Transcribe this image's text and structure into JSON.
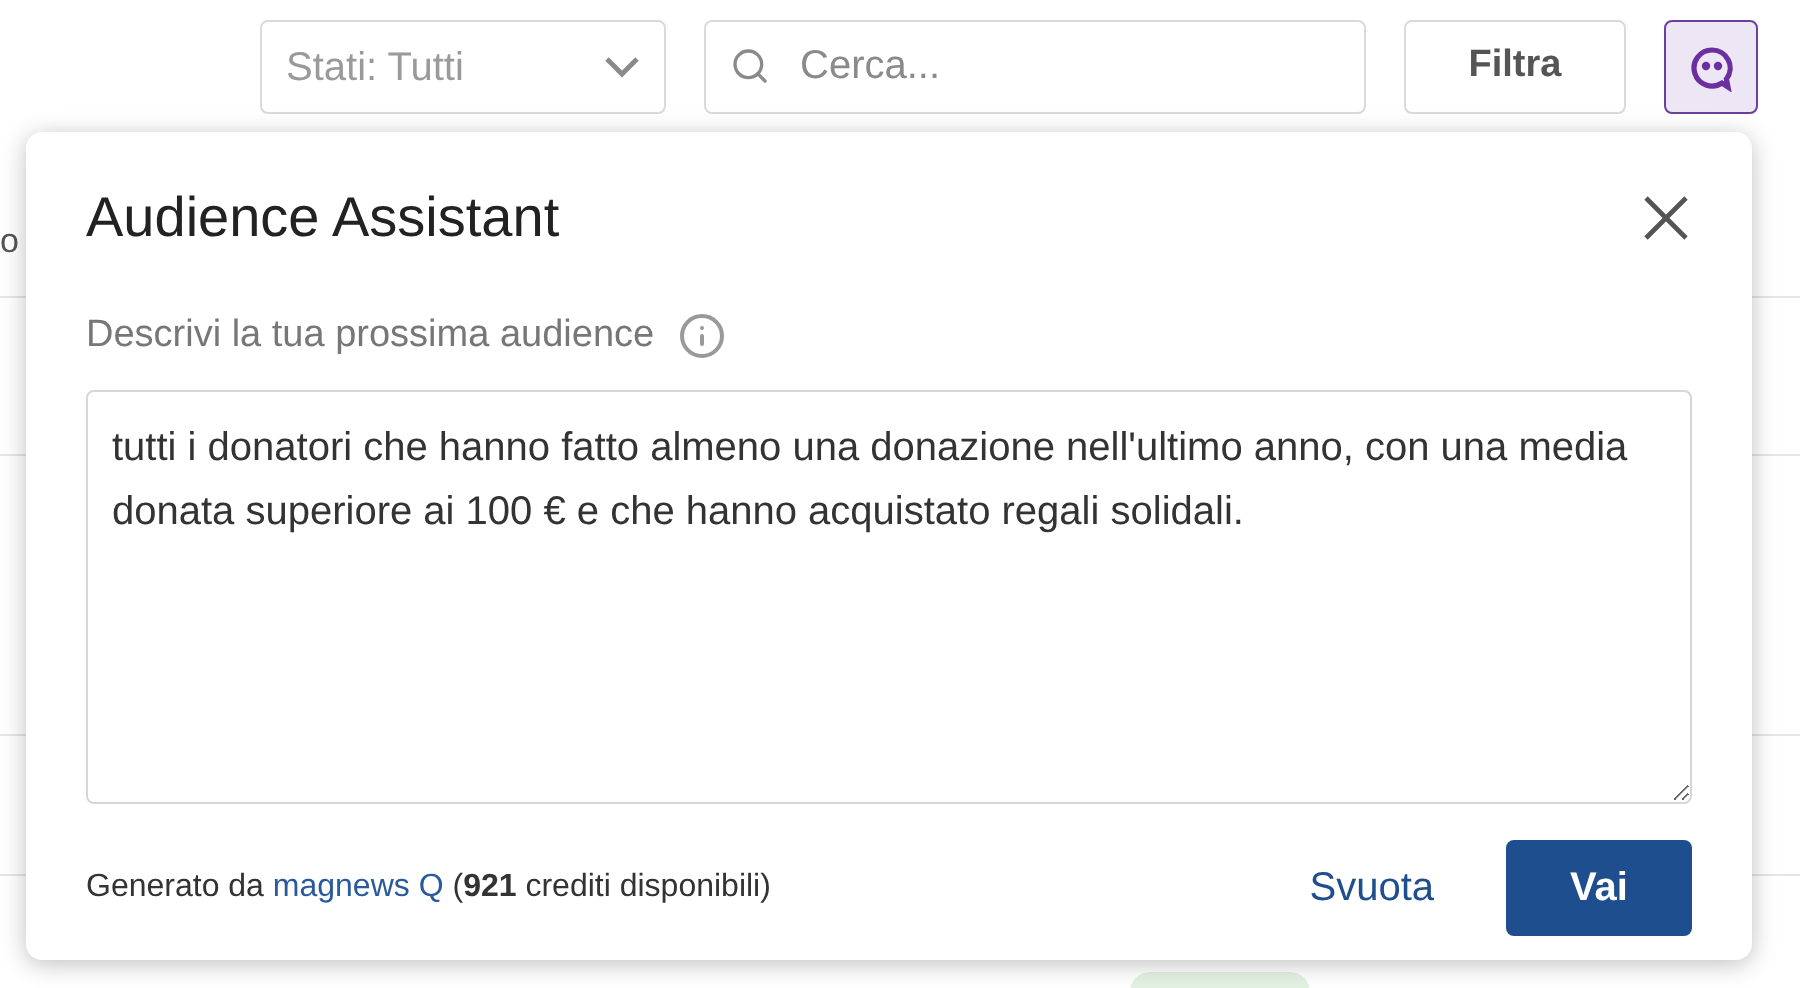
{
  "toolbar": {
    "status_select": {
      "value": "Stati: Tutti"
    },
    "search": {
      "placeholder": "Cerca..."
    },
    "filter_button": "Filtra",
    "assistant_button": {
      "selected": true
    }
  },
  "background": {
    "column_fragment": "o"
  },
  "dialog": {
    "title": "Audience Assistant",
    "prompt_label": "Descrivi la tua prossima audience",
    "prompt_value": "tutti i donatori che hanno fatto almeno una donazione nell'ultimo anno, con una media donata superiore ai 100 € e che hanno acquistato regali solidali.",
    "footer": {
      "prefix": "Generato da",
      "link": "magnews Q",
      "suffix": "(**921** crediti disponibili)"
    },
    "clear_button": "Svuota",
    "go_button": "Vai"
  }
}
